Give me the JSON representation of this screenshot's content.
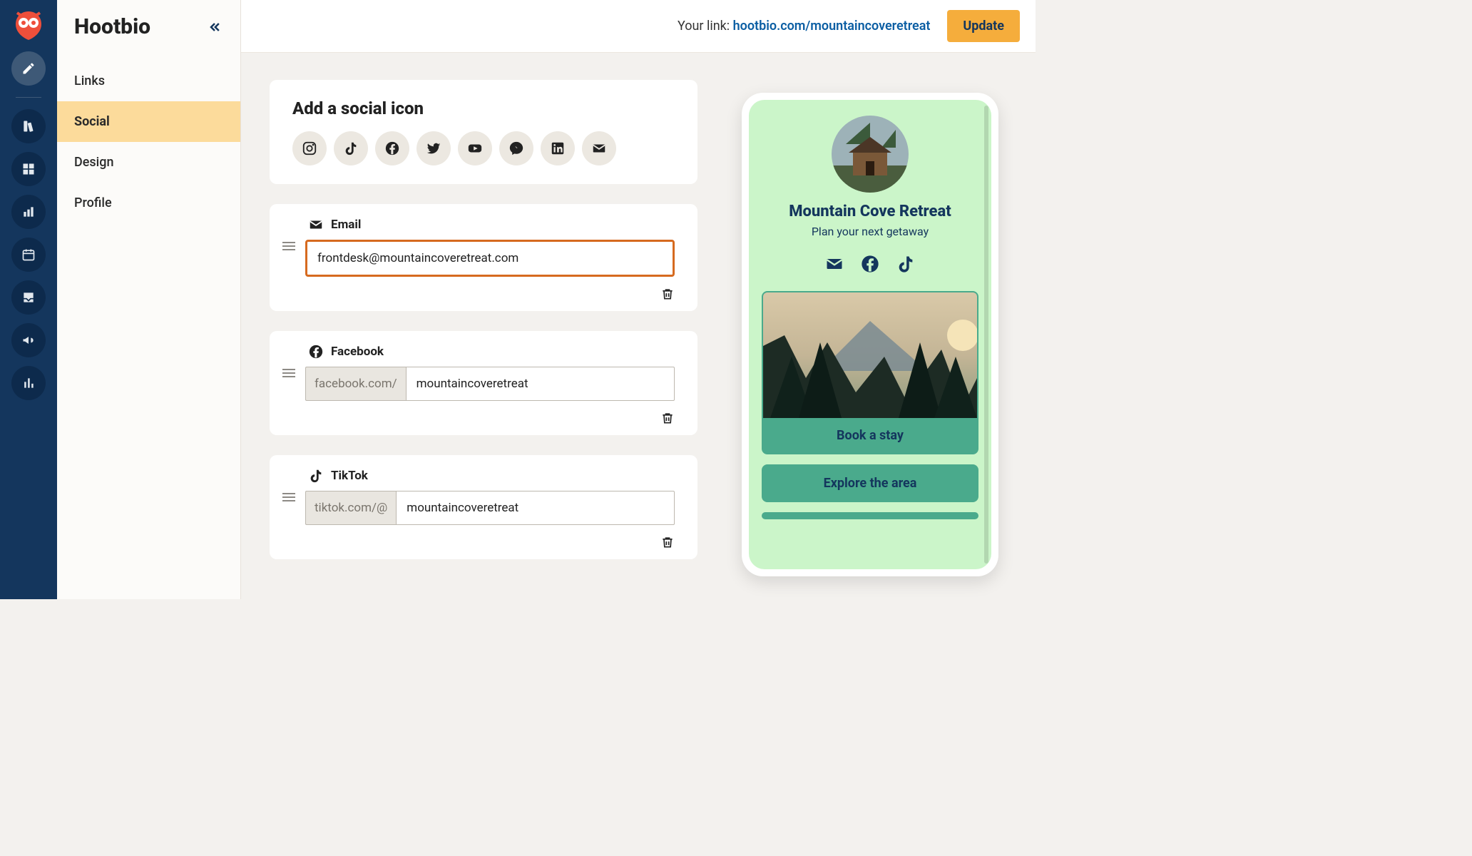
{
  "brand": "Hootbio",
  "topbar": {
    "link_label": "Your link:",
    "link_url": "hootbio.com/mountaincoveretreat",
    "update": "Update"
  },
  "sidenav": {
    "items": [
      {
        "label": "Links"
      },
      {
        "label": "Social"
      },
      {
        "label": "Design"
      },
      {
        "label": "Profile"
      }
    ],
    "active_index": 1
  },
  "rail_icons": [
    "compose-icon",
    "swatches-icon",
    "grid-icon",
    "analytics-icon",
    "calendar-icon",
    "inbox-icon",
    "megaphone-icon",
    "bar-chart-icon"
  ],
  "add_social": {
    "heading": "Add a social icon",
    "options": [
      "instagram",
      "tiktok",
      "facebook",
      "twitter",
      "youtube",
      "messenger",
      "linkedin",
      "email"
    ]
  },
  "socials": [
    {
      "kind": "email",
      "title": "Email",
      "prefix": "",
      "value": "frontdesk@mountaincoveretreat.com",
      "focused": true
    },
    {
      "kind": "facebook",
      "title": "Facebook",
      "prefix": "facebook.com/",
      "value": "mountaincoveretreat",
      "focused": false
    },
    {
      "kind": "tiktok",
      "title": "TikTok",
      "prefix": "tiktok.com/@",
      "value": "mountaincoveretreat",
      "focused": false
    }
  ],
  "preview": {
    "name": "Mountain Cove Retreat",
    "tagline": "Plan your next getaway",
    "socials": [
      "email",
      "facebook",
      "tiktok"
    ],
    "links": [
      {
        "label": "Book a stay",
        "has_image": true
      },
      {
        "label": "Explore the area",
        "has_image": false
      }
    ]
  }
}
